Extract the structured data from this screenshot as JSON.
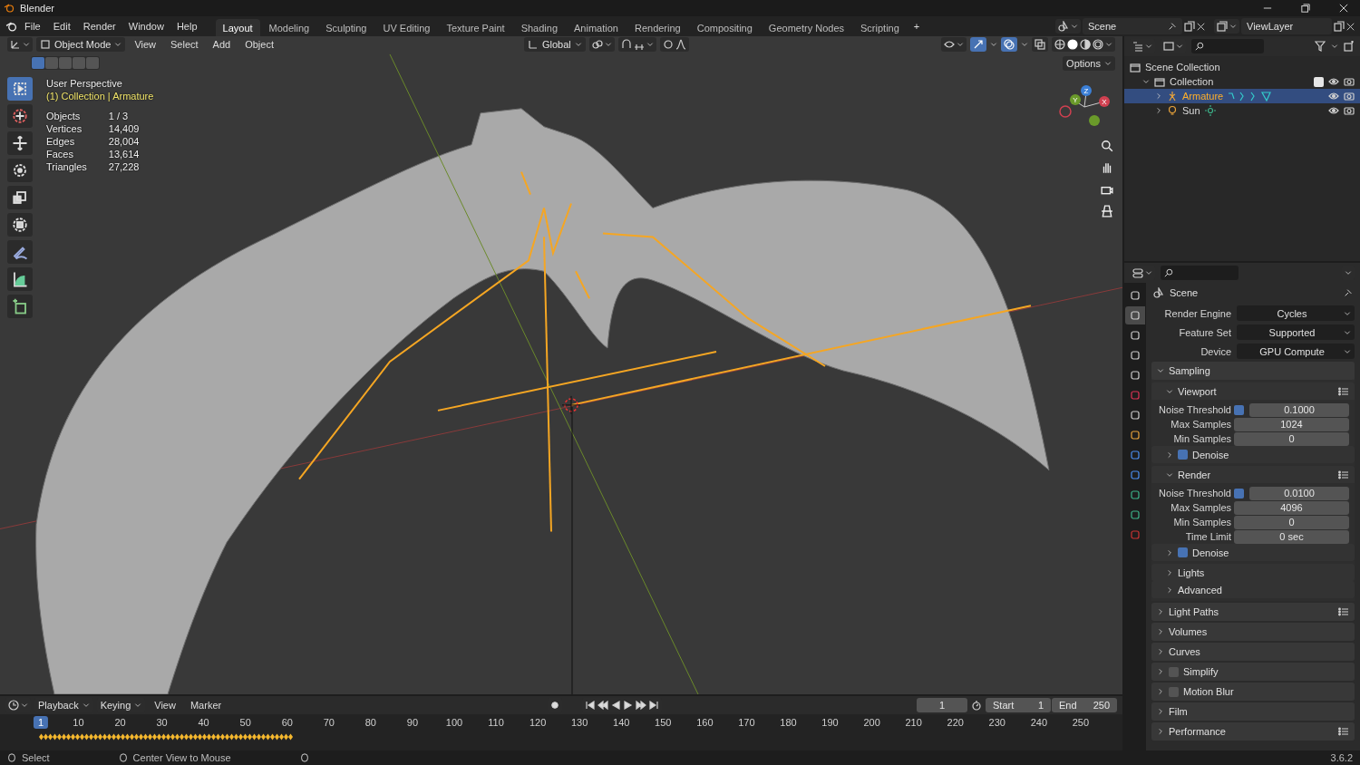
{
  "window": {
    "title": "Blender"
  },
  "menu": [
    "File",
    "Edit",
    "Render",
    "Window",
    "Help"
  ],
  "workspaces": [
    {
      "label": "Layout",
      "selected": true
    },
    {
      "label": "Modeling",
      "selected": false
    },
    {
      "label": "Sculpting",
      "selected": false
    },
    {
      "label": "UV Editing",
      "selected": false
    },
    {
      "label": "Texture Paint",
      "selected": false
    },
    {
      "label": "Shading",
      "selected": false
    },
    {
      "label": "Animation",
      "selected": false
    },
    {
      "label": "Rendering",
      "selected": false
    },
    {
      "label": "Compositing",
      "selected": false
    },
    {
      "label": "Geometry Nodes",
      "selected": false
    },
    {
      "label": "Scripting",
      "selected": false
    }
  ],
  "add_workspace": "+",
  "scene": "Scene",
  "view_layer": "ViewLayer",
  "viewport": {
    "mode": "Object Mode",
    "menus": [
      "View",
      "Select",
      "Add",
      "Object"
    ],
    "orientation": "Global",
    "options": "Options",
    "view_name": "User Perspective",
    "context": "(1) Collection | Armature",
    "stats": [
      {
        "label": "Objects",
        "value": "1 / 3"
      },
      {
        "label": "Vertices",
        "value": "14,409"
      },
      {
        "label": "Edges",
        "value": "28,004"
      },
      {
        "label": "Faces",
        "value": "13,614"
      },
      {
        "label": "Triangles",
        "value": "27,228"
      }
    ],
    "select_modes": [
      {
        "selected": true
      },
      {
        "selected": false
      },
      {
        "selected": false
      },
      {
        "selected": false
      },
      {
        "selected": false
      }
    ],
    "tools": [
      {
        "kind": "select",
        "selected": true
      },
      {
        "kind": "cursor",
        "selected": false
      },
      {
        "kind": "move",
        "selected": false
      },
      {
        "kind": "rotate",
        "selected": false
      },
      {
        "kind": "scale",
        "selected": false
      },
      {
        "kind": "transform",
        "selected": false
      },
      {
        "kind": "annotate",
        "selected": false
      },
      {
        "kind": "measure",
        "selected": false
      },
      {
        "kind": "add-cube",
        "selected": false
      }
    ],
    "gizmo_axes": [
      "Z",
      "Y",
      "X"
    ]
  },
  "outliner": {
    "items": [
      {
        "label": "Scene Collection",
        "kind": "scene",
        "children": [
          {
            "label": "Collection",
            "kind": "collection",
            "expanded": true,
            "checked": true,
            "selected": false,
            "children": [
              {
                "label": "Armature",
                "kind": "armature",
                "expanded": false,
                "selected": true
              },
              {
                "label": "Sun",
                "kind": "light",
                "expanded": false,
                "selected": false
              }
            ]
          }
        ]
      }
    ]
  },
  "properties": {
    "header": "Scene",
    "tabs": [
      {
        "kind": "tool",
        "selected": false
      },
      {
        "kind": "render",
        "selected": true
      },
      {
        "kind": "output",
        "selected": false
      },
      {
        "kind": "view-layer",
        "selected": false
      },
      {
        "kind": "scene",
        "selected": false
      },
      {
        "kind": "world",
        "selected": false
      },
      {
        "kind": "collection",
        "selected": false
      },
      {
        "kind": "object",
        "selected": false
      },
      {
        "kind": "physics",
        "selected": false
      },
      {
        "kind": "constraints",
        "selected": false
      },
      {
        "kind": "data",
        "selected": false
      },
      {
        "kind": "bone",
        "selected": false
      },
      {
        "kind": "texture",
        "selected": false
      }
    ],
    "fields": [
      {
        "label": "Render Engine",
        "value": "Cycles"
      },
      {
        "label": "Feature Set",
        "value": "Supported"
      },
      {
        "label": "Device",
        "value": "GPU Compute"
      }
    ],
    "panels": [
      {
        "title": "Sampling",
        "expanded": true,
        "children": [
          {
            "title": "Viewport",
            "expanded": true,
            "presets": true,
            "rows": [
              {
                "label": "Noise Threshold",
                "checked": true,
                "value": "0.1000"
              },
              {
                "label": "Max Samples",
                "value": "1024"
              },
              {
                "label": "Min Samples",
                "value": "0"
              }
            ],
            "children": [
              {
                "title": "Denoise",
                "expanded": false,
                "checked": true
              }
            ]
          },
          {
            "title": "Render",
            "expanded": true,
            "presets": true,
            "rows": [
              {
                "label": "Noise Threshold",
                "checked": true,
                "value": "0.0100"
              },
              {
                "label": "Max Samples",
                "value": "4096"
              },
              {
                "label": "Min Samples",
                "value": "0"
              },
              {
                "label": "Time Limit",
                "value": "0 sec"
              }
            ],
            "children": [
              {
                "title": "Denoise",
                "expanded": false,
                "checked": true
              }
            ]
          },
          {
            "title": "Lights",
            "expanded": false
          },
          {
            "title": "Advanced",
            "expanded": false
          }
        ]
      },
      {
        "title": "Light Paths",
        "expanded": false,
        "presets": true
      },
      {
        "title": "Volumes",
        "expanded": false
      },
      {
        "title": "Curves",
        "expanded": false
      },
      {
        "title": "Simplify",
        "expanded": false,
        "checked": false
      },
      {
        "title": "Motion Blur",
        "expanded": false,
        "checked": false
      },
      {
        "title": "Film",
        "expanded": false
      },
      {
        "title": "Performance",
        "expanded": false,
        "presets": true
      }
    ]
  },
  "timeline": {
    "menus": [
      "Playback",
      "Keying",
      "View",
      "Marker"
    ],
    "current_frame": "1",
    "start_label": "Start",
    "start": "1",
    "end_label": "End",
    "end": "250",
    "playhead": "1",
    "ruler": [
      "10",
      "20",
      "30",
      "40",
      "50",
      "60",
      "70",
      "80",
      "90",
      "100",
      "110",
      "120",
      "130",
      "140",
      "150",
      "160",
      "170",
      "180",
      "190",
      "200",
      "210",
      "220",
      "230",
      "240",
      "250"
    ]
  },
  "status_bar": {
    "items": [
      "Select",
      "Center View to Mouse"
    ],
    "version": "3.6.2"
  }
}
